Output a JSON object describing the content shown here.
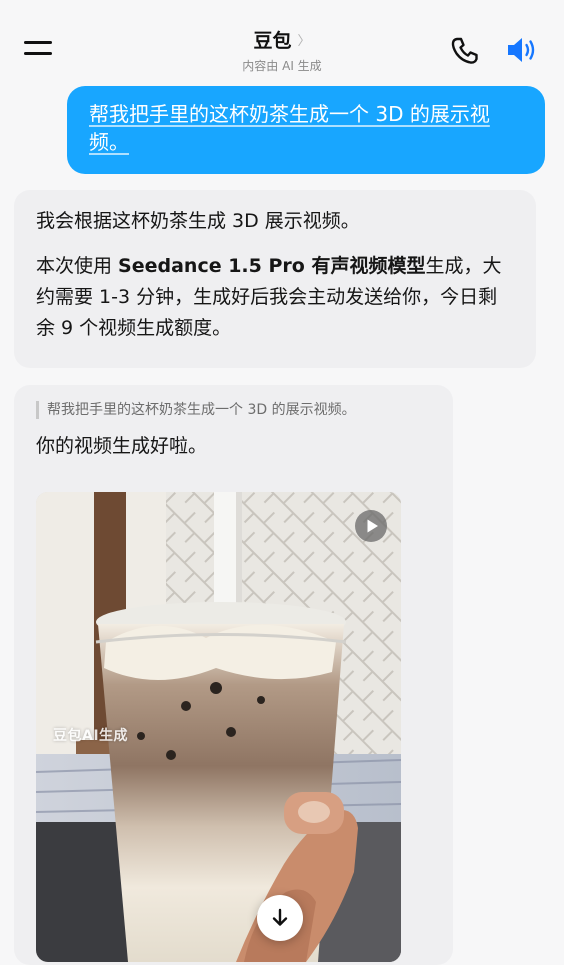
{
  "header": {
    "title": "豆包",
    "title_chevron": "〉",
    "subtitle": "内容由 AI 生成"
  },
  "icons": {
    "menu": "menu-icon",
    "phone": "phone-icon",
    "speaker": "speaker-icon",
    "play": "play-icon",
    "download": "arrow-down-icon"
  },
  "colors": {
    "accent": "#18a6ff",
    "bubble_gray": "#efeff1"
  },
  "messages": {
    "user": {
      "text": "帮我把手里的这杯奶茶生成一个 3D 的展示视频。"
    },
    "bot1": {
      "line1": "我会根据这杯奶茶生成 3D 展示视频。",
      "p2_prefix": "本次使用 ",
      "model_name": "Seedance 1.5 Pro 有声视频模型",
      "p2_suffix": "生成，大约需要 1-3 分钟，生成好后我会主动发送给你，今日剩余 9 个视频生成额度。"
    },
    "bot2": {
      "quote": "帮我把手里的这杯奶茶生成一个 3D 的展示视频。",
      "text": "你的视频生成好啦。",
      "video_watermark": "豆包AI生成"
    }
  }
}
